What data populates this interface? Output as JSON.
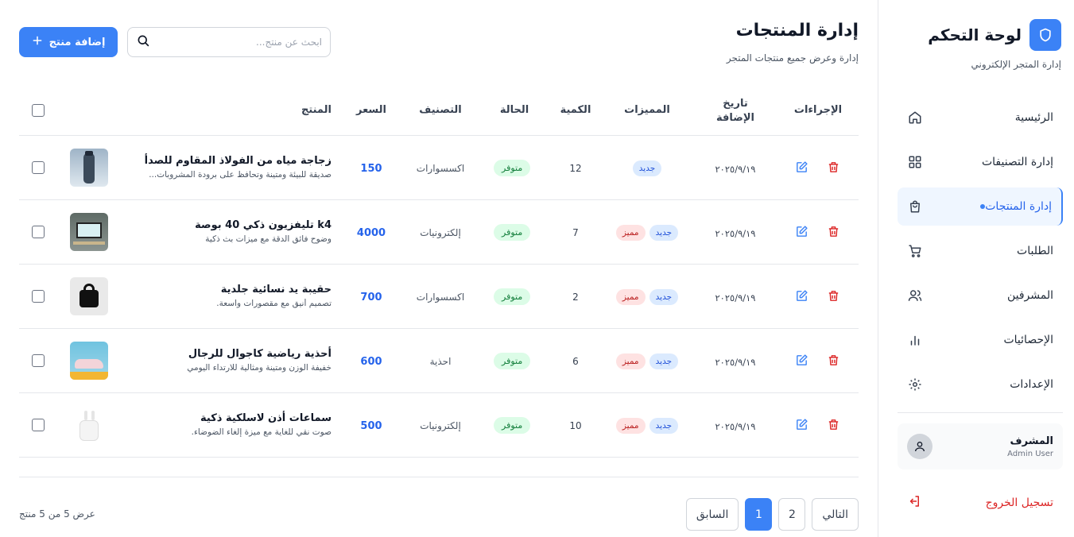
{
  "sidebar": {
    "brand_title": "لوحة التحكم",
    "brand_sub": "إدارة المتجر الإلكتروني",
    "items": [
      {
        "label": "الرئيسية",
        "icon": "home-icon"
      },
      {
        "label": "إدارة التصنيفات",
        "icon": "grid-icon"
      },
      {
        "label": "إدارة المنتجات",
        "icon": "shopping-bag-icon",
        "active": true
      },
      {
        "label": "الطلبات",
        "icon": "cart-icon"
      },
      {
        "label": "المشرفين",
        "icon": "users-icon"
      },
      {
        "label": "الإحصائيات",
        "icon": "bar-chart-icon"
      },
      {
        "label": "الإعدادات",
        "icon": "gear-icon"
      }
    ],
    "user": {
      "name": "المشرف",
      "role": "Admin User"
    },
    "logout": "تسجيل الخروج"
  },
  "header": {
    "title": "إدارة المنتجات",
    "subtitle": "إدارة وعرض جميع منتجات المتجر",
    "search_placeholder": "ابحث عن منتج...",
    "add_label": "إضافة منتج"
  },
  "table": {
    "headers": {
      "product": "المنتج",
      "price": "السعر",
      "category": "التصنيف",
      "status": "الحالة",
      "qty": "الكمية",
      "features": "المميزات",
      "date_line1": "تاريخ",
      "date_line2": "الإضافة",
      "actions": "الإجراءات"
    },
    "rows": [
      {
        "name": "زجاجة مياه من الفولاذ المقاوم للصدأ",
        "desc": "صديقة للبيئة ومتينة وتحافظ على برودة المشروبات...",
        "price": "150",
        "category": "اكسسوارات",
        "status": "متوفر",
        "qty": "12",
        "badges": [
          "جديد"
        ],
        "date": "٢٠٢٥/٩/١٩",
        "thumb": "bottle"
      },
      {
        "name": "k4 تليفزيون ذكي 40 بوصة",
        "desc": "وضوح فائق الدقة مع ميزات بث ذكية",
        "price": "4000",
        "category": "إلكترونيات",
        "status": "متوفر",
        "qty": "7",
        "badges": [
          "مميز",
          "جديد"
        ],
        "date": "٢٠٢٥/٩/١٩",
        "thumb": "tv"
      },
      {
        "name": "حقيبة يد نسائية جلدية",
        "desc": "تصميم أنيق مع مقصورات واسعة.",
        "price": "700",
        "category": "اكسسوارات",
        "status": "متوفر",
        "qty": "2",
        "badges": [
          "مميز",
          "جديد"
        ],
        "date": "٢٠٢٥/٩/١٩",
        "thumb": "bag"
      },
      {
        "name": "أحذية رياضية كاجوال للرجال",
        "desc": "خفيفة الوزن ومتينة ومثالية للارتداء اليومي",
        "price": "600",
        "category": "احذية",
        "status": "متوفر",
        "qty": "6",
        "badges": [
          "مميز",
          "جديد"
        ],
        "date": "٢٠٢٥/٩/١٩",
        "thumb": "shoes"
      },
      {
        "name": "سماعات أذن لاسلكية ذكية",
        "desc": "صوت نقي للغاية مع ميزة إلغاء الضوضاء.",
        "price": "500",
        "category": "إلكترونيات",
        "status": "متوفر",
        "qty": "10",
        "badges": [
          "مميز",
          "جديد"
        ],
        "date": "٢٠٢٥/٩/١٩",
        "thumb": "earbuds"
      }
    ]
  },
  "footer": {
    "count": "عرض 5 من 5 منتج",
    "next": "التالي",
    "prev": "السابق",
    "pages": [
      "1",
      "2"
    ]
  },
  "colors": {
    "accent": "#3b82f6",
    "danger": "#dc2626",
    "success": "#15803d"
  }
}
